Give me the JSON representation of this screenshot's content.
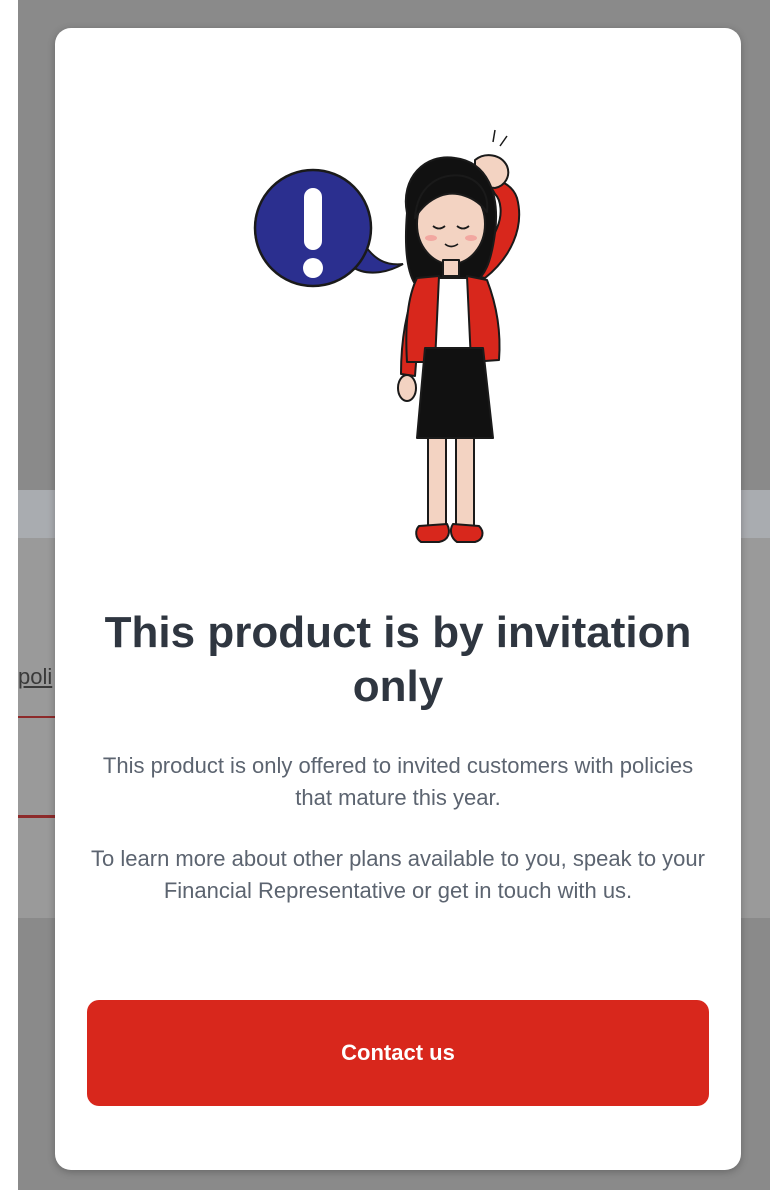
{
  "background": {
    "partial_text": "poli"
  },
  "modal": {
    "illustration": {
      "speech_bubble_glyph": "!",
      "colors": {
        "bubble": "#2b2f8f",
        "jacket": "#d8271c",
        "skirt": "#111111",
        "shoes": "#d8271c"
      }
    },
    "title": "This product is by invitation only",
    "description_1": "This product is only offered to invited customers with policies that mature this year.",
    "description_2": "To learn more about other plans available to you, speak to your Financial Representative or get in touch with us.",
    "cta_label": "Contact us"
  },
  "colors": {
    "accent": "#d8271c",
    "title_text": "#2f3640",
    "body_text": "#5c6470",
    "overlay": "#8a8a8a"
  }
}
